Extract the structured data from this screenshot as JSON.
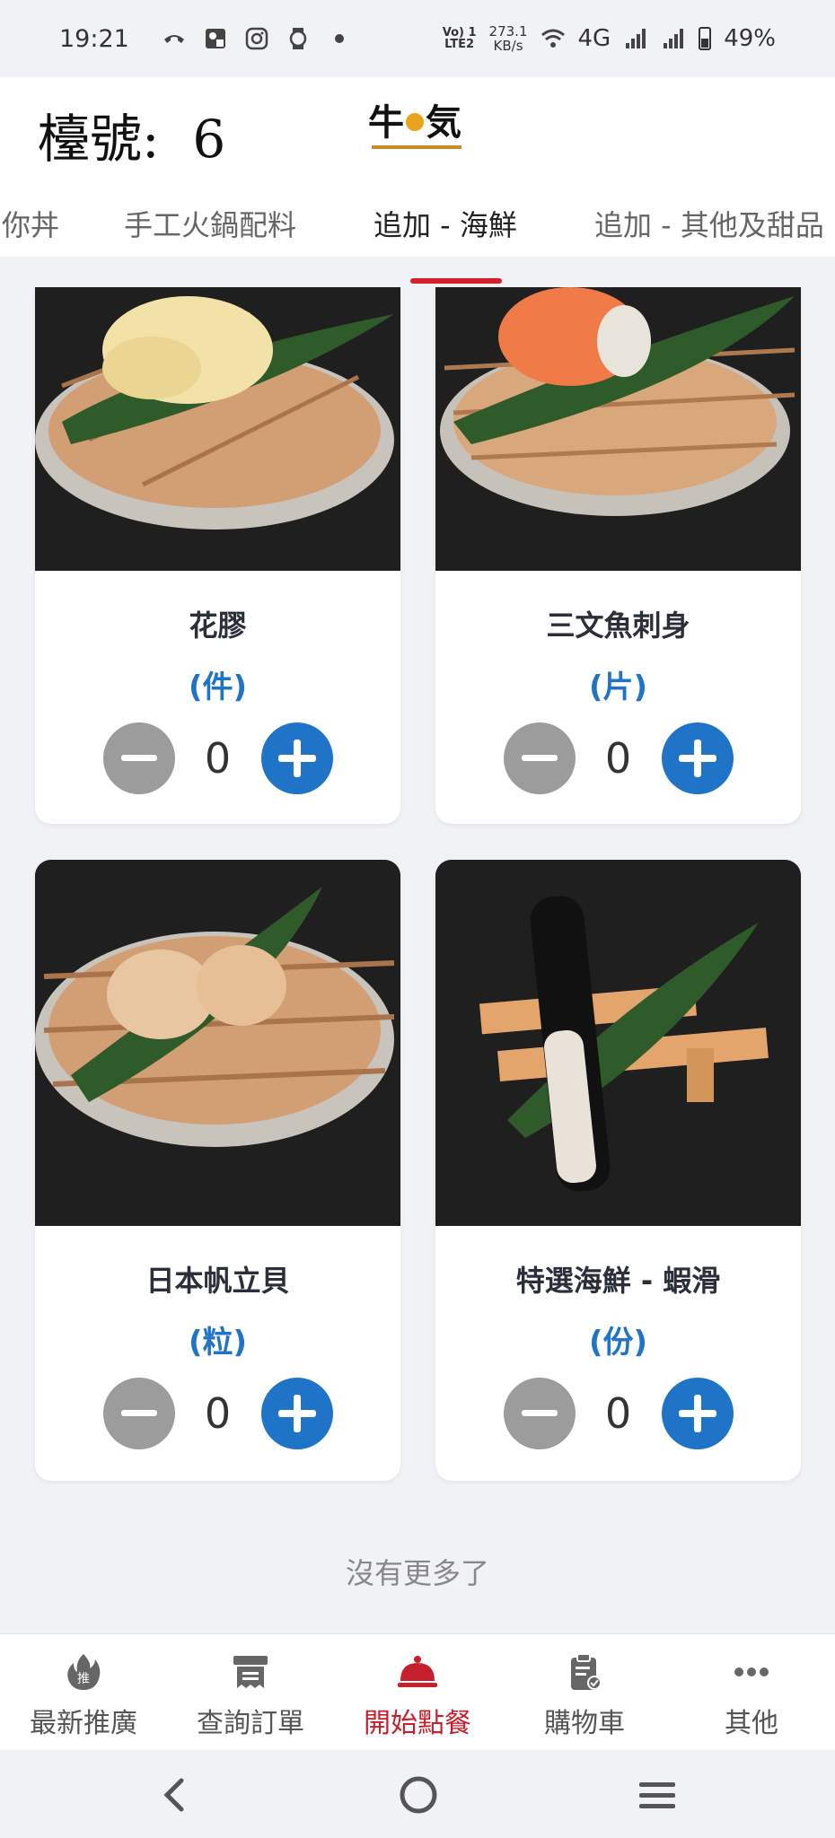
{
  "status_bar": {
    "time": "19:21",
    "network_top": "Vo) 1",
    "network_bottom": "LTE2",
    "speed_value": "273.1",
    "speed_unit": "KB/s",
    "signal_type": "4G",
    "battery": "49%"
  },
  "header": {
    "table_label": "檯號:",
    "table_number": "6"
  },
  "tabs": [
    {
      "label": "你丼",
      "active": false
    },
    {
      "label": "手工火鍋配料",
      "active": false
    },
    {
      "label": "追加 - 海鮮",
      "active": true
    },
    {
      "label": "追加 - 其他及甜品",
      "active": false
    }
  ],
  "items": [
    {
      "name": "花膠",
      "unit": "(件)",
      "qty": "0",
      "icon": "fish-maw-photo"
    },
    {
      "name": "三文魚刺身",
      "unit": "(片)",
      "qty": "0",
      "icon": "salmon-sashimi-photo"
    },
    {
      "name": "日本帆立貝",
      "unit": "(粒)",
      "qty": "0",
      "icon": "scallop-photo"
    },
    {
      "name": "特選海鮮 - 蝦滑",
      "unit": "(份)",
      "qty": "0",
      "icon": "shrimp-paste-photo"
    }
  ],
  "list_end_text": "沒有更多了",
  "bottom_nav": [
    {
      "label": "最新推廣",
      "icon": "promo-fire-icon",
      "active": false
    },
    {
      "label": "查詢訂單",
      "icon": "order-query-icon",
      "active": false
    },
    {
      "label": "開始點餐",
      "icon": "cloche-icon",
      "active": true
    },
    {
      "label": "購物車",
      "icon": "clipboard-check-icon",
      "active": false
    },
    {
      "label": "其他",
      "icon": "more-dots-icon",
      "active": false
    }
  ],
  "colors": {
    "accent_blue": "#1f74c7",
    "active_red": "#c7202c",
    "minus_grey": "#9c9c9c"
  }
}
